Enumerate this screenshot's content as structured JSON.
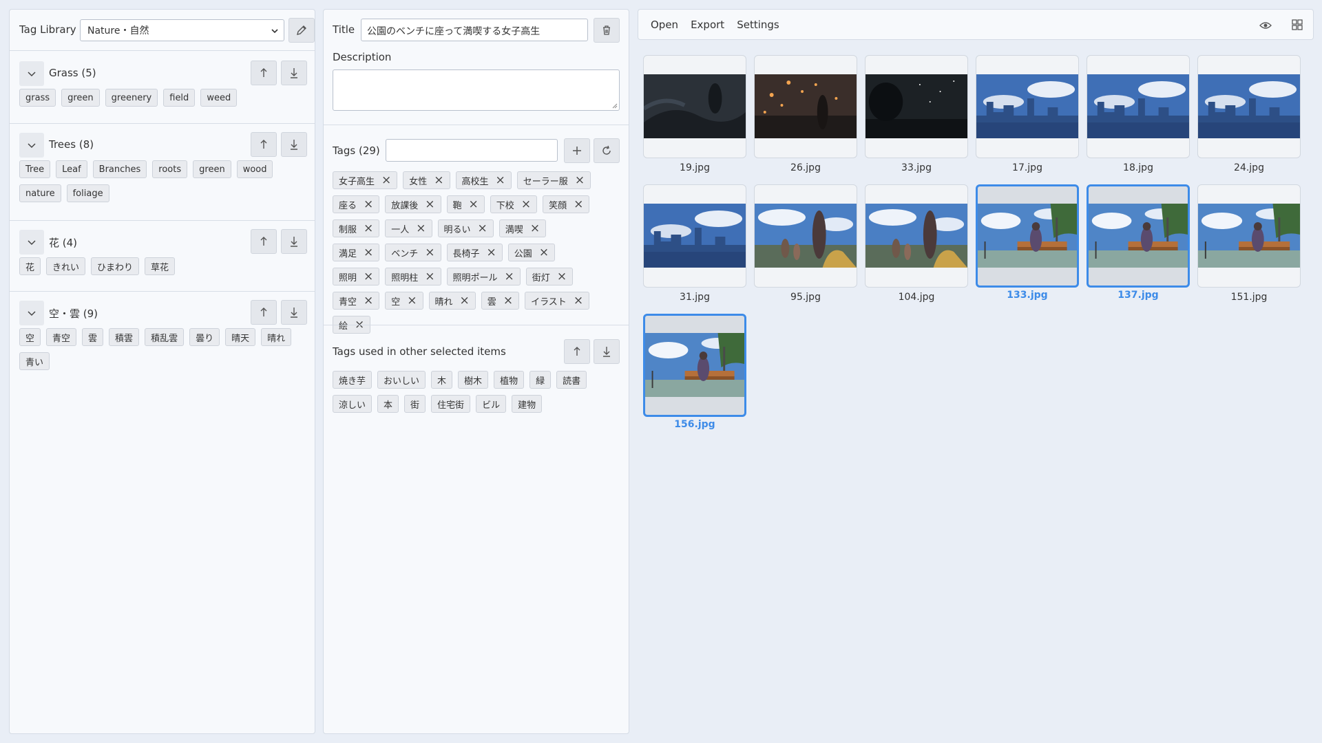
{
  "library": {
    "title": "Tag Library",
    "selected_library": "Nature・自然",
    "groups": [
      {
        "name": "Grass (5)",
        "tags": [
          "grass",
          "green",
          "greenery",
          "field",
          "weed"
        ]
      },
      {
        "name": "Trees (8)",
        "tags": [
          "Tree",
          "Leaf",
          "Branches",
          "roots",
          "green",
          "wood",
          "nature",
          "foliage"
        ]
      },
      {
        "name": "花 (4)",
        "tags": [
          "花",
          "きれい",
          "ひまわり",
          "草花"
        ]
      },
      {
        "name": "空・雲 (9)",
        "tags": [
          "空",
          "青空",
          "雲",
          "積雲",
          "積乱雲",
          "曇り",
          "晴天",
          "晴れ",
          "青い"
        ]
      }
    ]
  },
  "detail": {
    "title_label": "Title",
    "title_value": "公園のベンチに座って満喫する女子高生",
    "description_label": "Description",
    "description_value": "",
    "tags_label": "Tags (29)",
    "tag_input_value": "",
    "tags": [
      "女子高生",
      "女性",
      "高校生",
      "セーラー服",
      "座る",
      "放課後",
      "鞄",
      "下校",
      "笑顔",
      "制服",
      "一人",
      "明るい",
      "満喫",
      "満足",
      "ベンチ",
      "長椅子",
      "公園",
      "照明",
      "照明柱",
      "照明ポール",
      "街灯",
      "青空",
      "空",
      "晴れ",
      "雲",
      "イラスト",
      "絵"
    ],
    "other_tags_label": "Tags used in other selected items",
    "other_tags": [
      "焼き芋",
      "おいしい",
      "木",
      "樹木",
      "植物",
      "緑",
      "読書",
      "涼しい",
      "本",
      "街",
      "住宅街",
      "ビル",
      "建物"
    ]
  },
  "menu": {
    "open": "Open",
    "export": "Export",
    "settings": "Settings"
  },
  "images": [
    {
      "name": "19.jpg",
      "selected": false,
      "scene": "night"
    },
    {
      "name": "26.jpg",
      "selected": false,
      "scene": "lanterns"
    },
    {
      "name": "33.jpg",
      "selected": false,
      "scene": "stars"
    },
    {
      "name": "17.jpg",
      "selected": false,
      "scene": "city"
    },
    {
      "name": "18.jpg",
      "selected": false,
      "scene": "city"
    },
    {
      "name": "24.jpg",
      "selected": false,
      "scene": "city"
    },
    {
      "name": "31.jpg",
      "selected": false,
      "scene": "city"
    },
    {
      "name": "95.jpg",
      "selected": false,
      "scene": "people"
    },
    {
      "name": "104.jpg",
      "selected": false,
      "scene": "people"
    },
    {
      "name": "133.jpg",
      "selected": true,
      "scene": "bench"
    },
    {
      "name": "137.jpg",
      "selected": true,
      "scene": "bench"
    },
    {
      "name": "151.jpg",
      "selected": false,
      "scene": "bench"
    },
    {
      "name": "156.jpg",
      "selected": true,
      "scene": "bench"
    }
  ]
}
